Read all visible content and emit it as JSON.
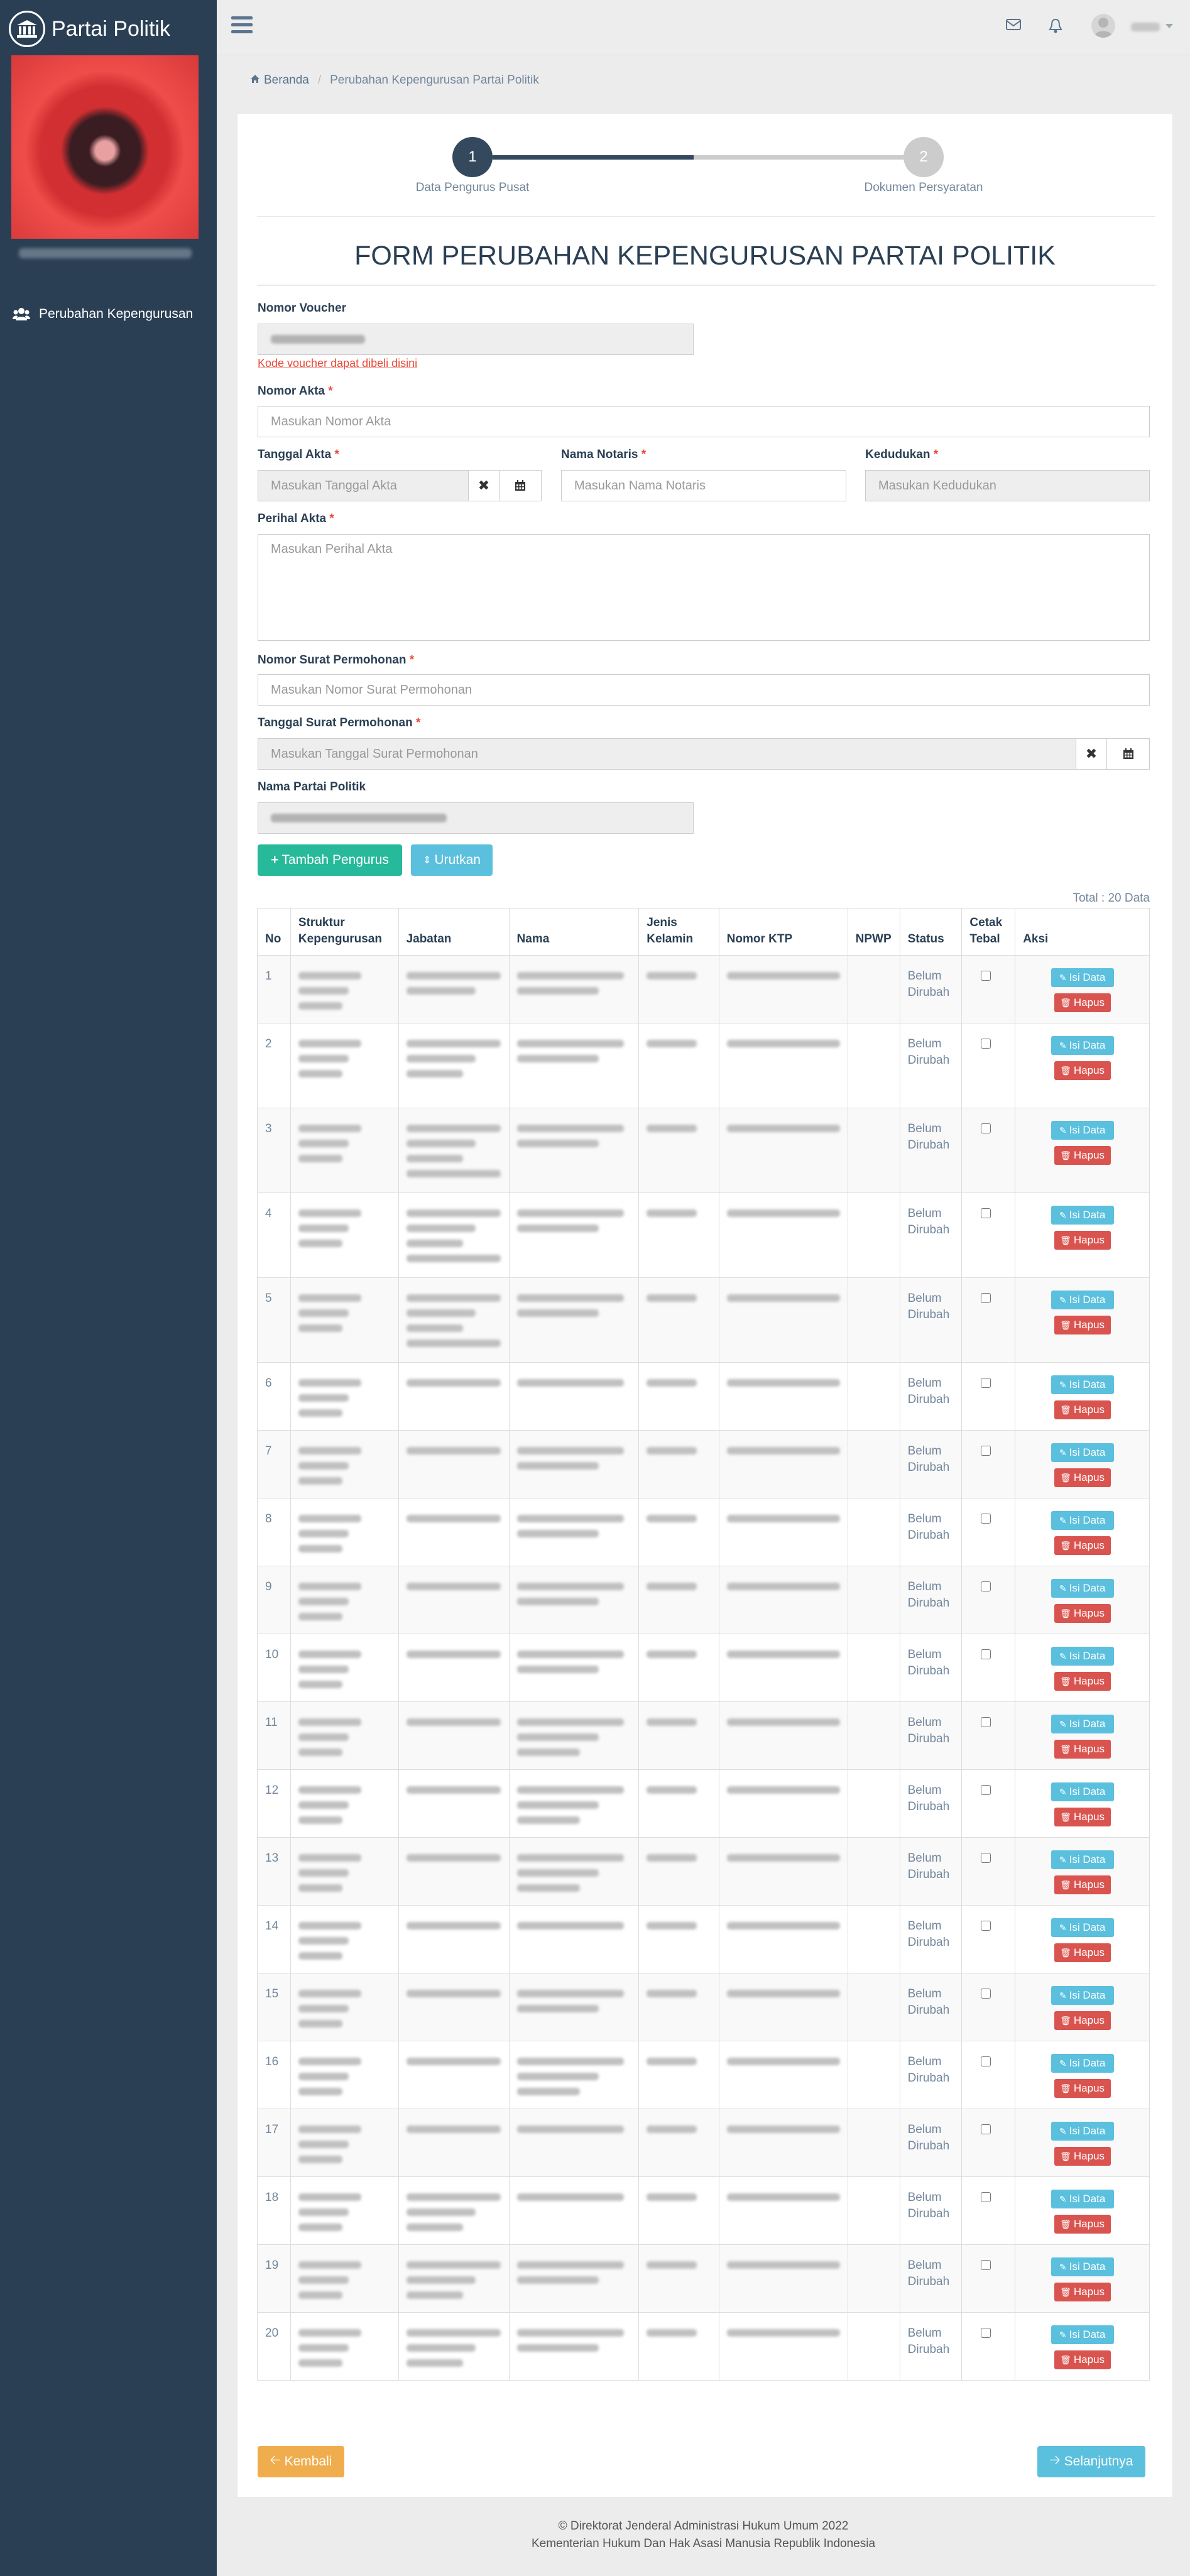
{
  "sidebar": {
    "brand": "Partai Politik",
    "menu_item": "Perubahan Kepengurusan"
  },
  "breadcrumb": {
    "home": "Beranda",
    "current": "Perubahan Kepengurusan Partai Politik"
  },
  "wizard": {
    "steps": [
      {
        "number": "1",
        "label": "Data Pengurus Pusat",
        "state": "active"
      },
      {
        "number": "2",
        "label": "Dokumen Persyaratan",
        "state": "inactive"
      }
    ]
  },
  "form": {
    "title": "FORM PERUBAHAN KEPENGURUSAN PARTAI POLITIK",
    "nomor_voucher": {
      "label": "Nomor Voucher",
      "link": "Kode voucher dapat dibeli disini"
    },
    "nomor_akta": {
      "label": "Nomor Akta",
      "placeholder": "Masukan Nomor Akta"
    },
    "tanggal_akta": {
      "label": "Tanggal Akta",
      "placeholder": "Masukan Tanggal Akta"
    },
    "nama_notaris": {
      "label": "Nama Notaris",
      "placeholder": "Masukan Nama Notaris"
    },
    "kedudukan": {
      "label": "Kedudukan",
      "placeholder": "Masukan Kedudukan"
    },
    "perihal_akta": {
      "label": "Perihal Akta",
      "placeholder": "Masukan Perihal Akta"
    },
    "nomor_surat": {
      "label": "Nomor Surat Permohonan",
      "placeholder": "Masukan Nomor Surat Permohonan"
    },
    "tanggal_surat": {
      "label": "Tanggal Surat Permohonan",
      "placeholder": "Masukan Tanggal Surat Permohonan"
    },
    "nama_partai": {
      "label": "Nama Partai Politik"
    },
    "required_mark": "*"
  },
  "buttons": {
    "tambah": "Tambah Pengurus",
    "urutkan": "Urutkan",
    "kembali": "Kembali",
    "selanjutnya": "Selanjutnya",
    "isi_data": "Isi Data",
    "hapus": "Hapus"
  },
  "table": {
    "total": "Total : 20 Data",
    "headers": [
      "No",
      "Struktur Kepengurusan",
      "Jabatan",
      "Nama",
      "Jenis Kelamin",
      "Nomor KTP",
      "NPWP",
      "Status",
      "Cetak Tebal",
      "Aksi"
    ],
    "rows": [
      {
        "no": "1",
        "status": "Belum Dirubah"
      },
      {
        "no": "2",
        "status": "Belum Dirubah"
      },
      {
        "no": "3",
        "status": "Belum Dirubah"
      },
      {
        "no": "4",
        "status": "Belum Dirubah"
      },
      {
        "no": "5",
        "status": "Belum Dirubah"
      },
      {
        "no": "6",
        "status": "Belum Dirubah"
      },
      {
        "no": "7",
        "status": "Belum Dirubah"
      },
      {
        "no": "8",
        "status": "Belum Dirubah"
      },
      {
        "no": "9",
        "status": "Belum Dirubah"
      },
      {
        "no": "10",
        "status": "Belum Dirubah"
      },
      {
        "no": "11",
        "status": "Belum Dirubah"
      },
      {
        "no": "12",
        "status": "Belum Dirubah"
      },
      {
        "no": "13",
        "status": "Belum Dirubah"
      },
      {
        "no": "14",
        "status": "Belum Dirubah"
      },
      {
        "no": "15",
        "status": "Belum Dirubah"
      },
      {
        "no": "16",
        "status": "Belum Dirubah"
      },
      {
        "no": "17",
        "status": "Belum Dirubah"
      },
      {
        "no": "18",
        "status": "Belum Dirubah"
      },
      {
        "no": "19",
        "status": "Belum Dirubah"
      },
      {
        "no": "20",
        "status": "Belum Dirubah"
      }
    ]
  },
  "footer": {
    "line1": "© Direktorat Jenderal Administrasi Hukum Umum 2022",
    "line2": "Kementerian Hukum Dan Hak Asasi Manusia Republik Indonesia"
  },
  "colors": {
    "sidebar": "#2a3f54",
    "success": "#26b99a",
    "info": "#5bc0de",
    "danger": "#d9534f",
    "warning": "#f0ad4e"
  }
}
